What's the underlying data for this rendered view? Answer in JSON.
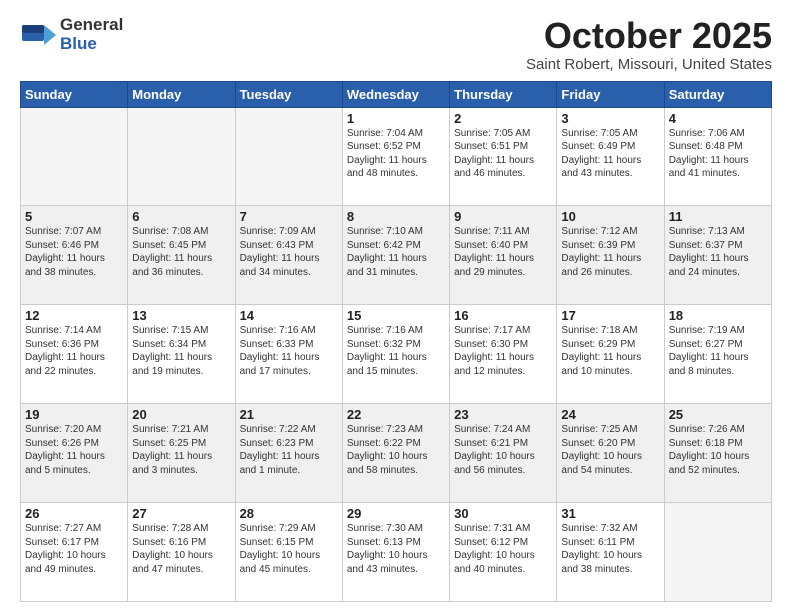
{
  "header": {
    "logo_general": "General",
    "logo_blue": "Blue",
    "month_title": "October 2025",
    "location": "Saint Robert, Missouri, United States"
  },
  "weekdays": [
    "Sunday",
    "Monday",
    "Tuesday",
    "Wednesday",
    "Thursday",
    "Friday",
    "Saturday"
  ],
  "weeks": [
    [
      {
        "day": "",
        "info": "",
        "empty": true
      },
      {
        "day": "",
        "info": "",
        "empty": true
      },
      {
        "day": "",
        "info": "",
        "empty": true
      },
      {
        "day": "1",
        "info": "Sunrise: 7:04 AM\nSunset: 6:52 PM\nDaylight: 11 hours\nand 48 minutes."
      },
      {
        "day": "2",
        "info": "Sunrise: 7:05 AM\nSunset: 6:51 PM\nDaylight: 11 hours\nand 46 minutes."
      },
      {
        "day": "3",
        "info": "Sunrise: 7:05 AM\nSunset: 6:49 PM\nDaylight: 11 hours\nand 43 minutes."
      },
      {
        "day": "4",
        "info": "Sunrise: 7:06 AM\nSunset: 6:48 PM\nDaylight: 11 hours\nand 41 minutes."
      }
    ],
    [
      {
        "day": "5",
        "info": "Sunrise: 7:07 AM\nSunset: 6:46 PM\nDaylight: 11 hours\nand 38 minutes.",
        "shaded": true
      },
      {
        "day": "6",
        "info": "Sunrise: 7:08 AM\nSunset: 6:45 PM\nDaylight: 11 hours\nand 36 minutes.",
        "shaded": true
      },
      {
        "day": "7",
        "info": "Sunrise: 7:09 AM\nSunset: 6:43 PM\nDaylight: 11 hours\nand 34 minutes.",
        "shaded": true
      },
      {
        "day": "8",
        "info": "Sunrise: 7:10 AM\nSunset: 6:42 PM\nDaylight: 11 hours\nand 31 minutes.",
        "shaded": true
      },
      {
        "day": "9",
        "info": "Sunrise: 7:11 AM\nSunset: 6:40 PM\nDaylight: 11 hours\nand 29 minutes.",
        "shaded": true
      },
      {
        "day": "10",
        "info": "Sunrise: 7:12 AM\nSunset: 6:39 PM\nDaylight: 11 hours\nand 26 minutes.",
        "shaded": true
      },
      {
        "day": "11",
        "info": "Sunrise: 7:13 AM\nSunset: 6:37 PM\nDaylight: 11 hours\nand 24 minutes.",
        "shaded": true
      }
    ],
    [
      {
        "day": "12",
        "info": "Sunrise: 7:14 AM\nSunset: 6:36 PM\nDaylight: 11 hours\nand 22 minutes."
      },
      {
        "day": "13",
        "info": "Sunrise: 7:15 AM\nSunset: 6:34 PM\nDaylight: 11 hours\nand 19 minutes."
      },
      {
        "day": "14",
        "info": "Sunrise: 7:16 AM\nSunset: 6:33 PM\nDaylight: 11 hours\nand 17 minutes."
      },
      {
        "day": "15",
        "info": "Sunrise: 7:16 AM\nSunset: 6:32 PM\nDaylight: 11 hours\nand 15 minutes."
      },
      {
        "day": "16",
        "info": "Sunrise: 7:17 AM\nSunset: 6:30 PM\nDaylight: 11 hours\nand 12 minutes."
      },
      {
        "day": "17",
        "info": "Sunrise: 7:18 AM\nSunset: 6:29 PM\nDaylight: 11 hours\nand 10 minutes."
      },
      {
        "day": "18",
        "info": "Sunrise: 7:19 AM\nSunset: 6:27 PM\nDaylight: 11 hours\nand 8 minutes."
      }
    ],
    [
      {
        "day": "19",
        "info": "Sunrise: 7:20 AM\nSunset: 6:26 PM\nDaylight: 11 hours\nand 5 minutes.",
        "shaded": true
      },
      {
        "day": "20",
        "info": "Sunrise: 7:21 AM\nSunset: 6:25 PM\nDaylight: 11 hours\nand 3 minutes.",
        "shaded": true
      },
      {
        "day": "21",
        "info": "Sunrise: 7:22 AM\nSunset: 6:23 PM\nDaylight: 11 hours\nand 1 minute.",
        "shaded": true
      },
      {
        "day": "22",
        "info": "Sunrise: 7:23 AM\nSunset: 6:22 PM\nDaylight: 10 hours\nand 58 minutes.",
        "shaded": true
      },
      {
        "day": "23",
        "info": "Sunrise: 7:24 AM\nSunset: 6:21 PM\nDaylight: 10 hours\nand 56 minutes.",
        "shaded": true
      },
      {
        "day": "24",
        "info": "Sunrise: 7:25 AM\nSunset: 6:20 PM\nDaylight: 10 hours\nand 54 minutes.",
        "shaded": true
      },
      {
        "day": "25",
        "info": "Sunrise: 7:26 AM\nSunset: 6:18 PM\nDaylight: 10 hours\nand 52 minutes.",
        "shaded": true
      }
    ],
    [
      {
        "day": "26",
        "info": "Sunrise: 7:27 AM\nSunset: 6:17 PM\nDaylight: 10 hours\nand 49 minutes."
      },
      {
        "day": "27",
        "info": "Sunrise: 7:28 AM\nSunset: 6:16 PM\nDaylight: 10 hours\nand 47 minutes."
      },
      {
        "day": "28",
        "info": "Sunrise: 7:29 AM\nSunset: 6:15 PM\nDaylight: 10 hours\nand 45 minutes."
      },
      {
        "day": "29",
        "info": "Sunrise: 7:30 AM\nSunset: 6:13 PM\nDaylight: 10 hours\nand 43 minutes."
      },
      {
        "day": "30",
        "info": "Sunrise: 7:31 AM\nSunset: 6:12 PM\nDaylight: 10 hours\nand 40 minutes."
      },
      {
        "day": "31",
        "info": "Sunrise: 7:32 AM\nSunset: 6:11 PM\nDaylight: 10 hours\nand 38 minutes."
      },
      {
        "day": "",
        "info": "",
        "empty": true
      }
    ]
  ]
}
